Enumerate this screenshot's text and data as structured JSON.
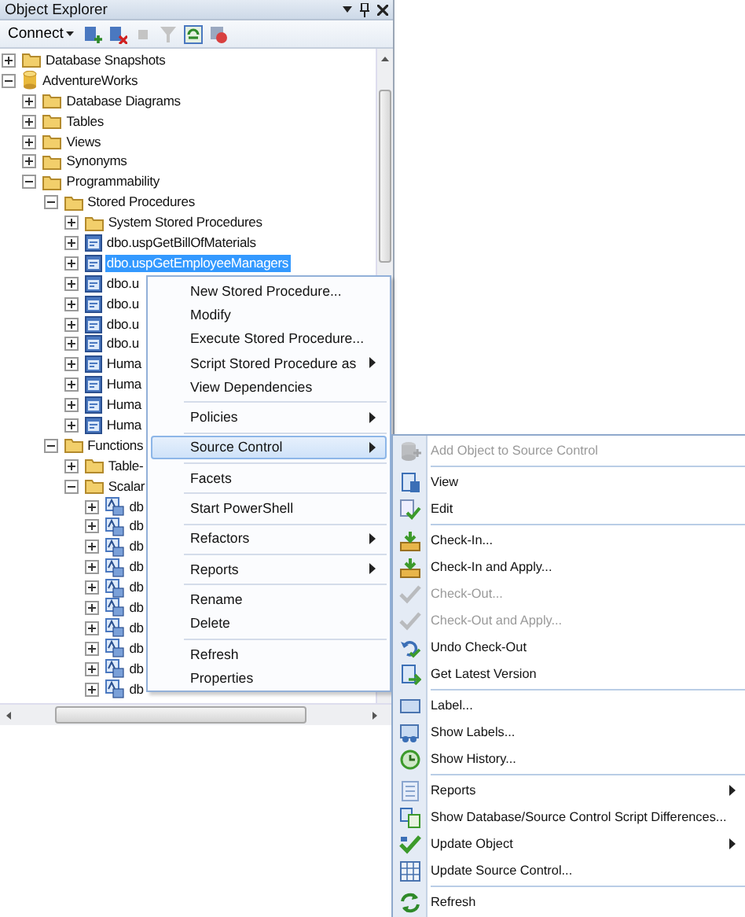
{
  "panel": {
    "title": "Object Explorer"
  },
  "toolbar": {
    "connect": "Connect"
  },
  "tree": [
    {
      "label": "Database Snapshots",
      "kind": "folder",
      "expanded": false,
      "selected": false
    },
    {
      "label": "AdventureWorks",
      "kind": "database",
      "expanded": true,
      "selected": false,
      "children": [
        {
          "label": "Database Diagrams",
          "kind": "folder",
          "expanded": false,
          "selected": false
        },
        {
          "label": "Tables",
          "kind": "folder",
          "expanded": false,
          "selected": false
        },
        {
          "label": "Views",
          "kind": "folder",
          "expanded": false,
          "selected": false
        },
        {
          "label": "Synonyms",
          "kind": "folder",
          "expanded": false,
          "selected": false
        },
        {
          "label": "Programmability",
          "kind": "folder",
          "expanded": true,
          "selected": false,
          "children": [
            {
              "label": "Stored Procedures",
              "kind": "folder",
              "expanded": true,
              "selected": false,
              "children": [
                {
                  "label": "System Stored Procedures",
                  "kind": "folder",
                  "expanded": false,
                  "selected": false
                },
                {
                  "label": "dbo.uspGetBillOfMaterials",
                  "kind": "procedure",
                  "expanded": false,
                  "selected": false
                },
                {
                  "label": "dbo.uspGetEmployeeManagers",
                  "kind": "procedure",
                  "expanded": false,
                  "selected": true
                },
                {
                  "label": "dbo.u",
                  "kind": "procedure",
                  "expanded": false,
                  "selected": false
                },
                {
                  "label": "dbo.u",
                  "kind": "procedure",
                  "expanded": false,
                  "selected": false
                },
                {
                  "label": "dbo.u",
                  "kind": "procedure",
                  "expanded": false,
                  "selected": false
                },
                {
                  "label": "dbo.u",
                  "kind": "procedure",
                  "expanded": false,
                  "selected": false
                },
                {
                  "label": "Huma",
                  "kind": "procedure",
                  "expanded": false,
                  "selected": false
                },
                {
                  "label": "Huma",
                  "kind": "procedure",
                  "expanded": false,
                  "selected": false
                },
                {
                  "label": "Huma",
                  "kind": "procedure",
                  "expanded": false,
                  "selected": false
                },
                {
                  "label": "Huma",
                  "kind": "procedure",
                  "expanded": false,
                  "selected": false
                }
              ]
            },
            {
              "label": "Functions",
              "kind": "folder",
              "expanded": true,
              "selected": false,
              "children": [
                {
                  "label": "Table-",
                  "kind": "folder",
                  "expanded": false,
                  "selected": false
                },
                {
                  "label": "Scalar",
                  "kind": "folder",
                  "expanded": true,
                  "selected": false,
                  "children": [
                    {
                      "label": "db",
                      "kind": "function",
                      "expanded": false,
                      "selected": false
                    },
                    {
                      "label": "db",
                      "kind": "function",
                      "expanded": false,
                      "selected": false
                    },
                    {
                      "label": "db",
                      "kind": "function",
                      "expanded": false,
                      "selected": false
                    },
                    {
                      "label": "db",
                      "kind": "function",
                      "expanded": false,
                      "selected": false
                    },
                    {
                      "label": "db",
                      "kind": "function",
                      "expanded": false,
                      "selected": false
                    },
                    {
                      "label": "db",
                      "kind": "function",
                      "expanded": false,
                      "selected": false
                    },
                    {
                      "label": "db",
                      "kind": "function",
                      "expanded": false,
                      "selected": false
                    },
                    {
                      "label": "db",
                      "kind": "function",
                      "expanded": false,
                      "selected": false
                    },
                    {
                      "label": "db",
                      "kind": "function",
                      "expanded": false,
                      "selected": false
                    },
                    {
                      "label": "db",
                      "kind": "function",
                      "expanded": false,
                      "selected": false
                    }
                  ]
                }
              ]
            }
          ]
        }
      ]
    }
  ],
  "context_menu": {
    "groups": [
      [
        {
          "label": "New Stored Procedure...",
          "submenu": false,
          "selected": false
        },
        {
          "label": "Modify",
          "submenu": false,
          "selected": false
        },
        {
          "label": "Execute Stored Procedure...",
          "submenu": false,
          "selected": false
        },
        {
          "label": "Script Stored Procedure as",
          "submenu": true,
          "selected": false
        },
        {
          "label": "View Dependencies",
          "submenu": false,
          "selected": false
        }
      ],
      [
        {
          "label": "Policies",
          "submenu": true,
          "selected": false
        }
      ],
      [
        {
          "label": "Source Control",
          "submenu": true,
          "selected": true
        }
      ],
      [
        {
          "label": "Facets",
          "submenu": false,
          "selected": false
        }
      ],
      [
        {
          "label": "Start PowerShell",
          "submenu": false,
          "selected": false
        }
      ],
      [
        {
          "label": "Refactors",
          "submenu": true,
          "selected": false
        }
      ],
      [
        {
          "label": "Reports",
          "submenu": true,
          "selected": false
        }
      ],
      [
        {
          "label": "Rename",
          "submenu": false,
          "selected": false
        },
        {
          "label": "Delete",
          "submenu": false,
          "selected": false
        }
      ],
      [
        {
          "label": "Refresh",
          "submenu": false,
          "selected": false
        },
        {
          "label": "Properties",
          "submenu": false,
          "selected": false
        }
      ]
    ]
  },
  "submenu": {
    "groups": [
      [
        {
          "label": "Add Object to Source Control",
          "disabled": true,
          "submenu": false
        }
      ],
      [
        {
          "label": "View",
          "disabled": false,
          "submenu": false
        },
        {
          "label": "Edit",
          "disabled": false,
          "submenu": false
        }
      ],
      [
        {
          "label": "Check-In...",
          "disabled": false,
          "submenu": false
        },
        {
          "label": "Check-In and Apply...",
          "disabled": false,
          "submenu": false
        },
        {
          "label": "Check-Out...",
          "disabled": true,
          "submenu": false
        },
        {
          "label": "Check-Out and Apply...",
          "disabled": true,
          "submenu": false
        },
        {
          "label": "Undo Check-Out",
          "disabled": false,
          "submenu": false
        },
        {
          "label": "Get Latest Version",
          "disabled": false,
          "submenu": false
        }
      ],
      [
        {
          "label": "Label...",
          "disabled": false,
          "submenu": false
        },
        {
          "label": "Show Labels...",
          "disabled": false,
          "submenu": false
        },
        {
          "label": "Show History...",
          "disabled": false,
          "submenu": false
        }
      ],
      [
        {
          "label": "Reports",
          "disabled": false,
          "submenu": true
        },
        {
          "label": "Show Database/Source Control Script Differences...",
          "disabled": false,
          "submenu": false
        },
        {
          "label": "Update Object",
          "disabled": false,
          "submenu": true
        },
        {
          "label": "Update Source Control...",
          "disabled": false,
          "submenu": false
        }
      ],
      [
        {
          "label": "Refresh",
          "disabled": false,
          "submenu": false
        }
      ]
    ]
  }
}
